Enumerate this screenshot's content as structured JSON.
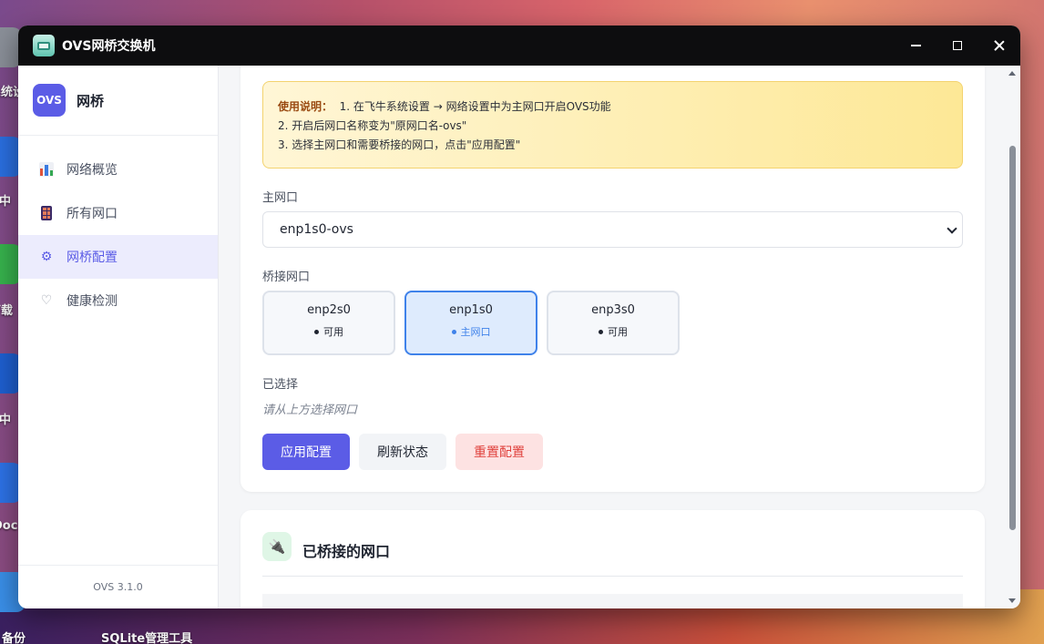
{
  "desktop": {
    "items": [
      {
        "label": "系统设"
      },
      {
        "label": "用中"
      },
      {
        "label": "下载"
      },
      {
        "label": "全中"
      },
      {
        "label": "Doc"
      },
      {
        "label": "备份"
      },
      {
        "label": "SQLite管理工具"
      }
    ]
  },
  "window": {
    "title": "OVS网桥交换机",
    "icon": "switch-app-icon"
  },
  "sidebar": {
    "brand_logo": "OVS",
    "brand_name": "网桥",
    "items": [
      {
        "label": "网络概览",
        "icon": "chart-icon"
      },
      {
        "label": "所有网口",
        "icon": "grid-icon"
      },
      {
        "label": "网桥配置",
        "icon": "gear-icon",
        "active": true
      },
      {
        "label": "健康检测",
        "icon": "shield-icon"
      }
    ],
    "version": "OVS 3.1.0"
  },
  "notice": {
    "title": "使用说明：",
    "lines": [
      "1. 在飞牛系统设置 → 网络设置中为主网口开启OVS功能",
      "2. 开启后网口名称变为\"原网口名-ovs\"",
      "3. 选择主网口和需要桥接的网口，点击\"应用配置\""
    ]
  },
  "form": {
    "main_label": "主网口",
    "main_value": "enp1s0-ovs",
    "bridge_label": "桥接网口",
    "interfaces": [
      {
        "name": "enp2s0",
        "status": "可用",
        "active": false
      },
      {
        "name": "enp1s0",
        "status": "主网口",
        "active": true
      },
      {
        "name": "enp3s0",
        "status": "可用",
        "active": false
      }
    ],
    "selected_label": "已选择",
    "selected_placeholder": "请从上方选择网口"
  },
  "actions": {
    "apply": "应用配置",
    "refresh": "刷新状态",
    "reset": "重置配置"
  },
  "bridged": {
    "title": "已桥接的网口",
    "icon": "plug-icon"
  },
  "colors": {
    "accent": "#5b5ce6",
    "active_blue": "#3f82ea",
    "danger": "#e0423d",
    "notice_bg": "#fde896"
  }
}
